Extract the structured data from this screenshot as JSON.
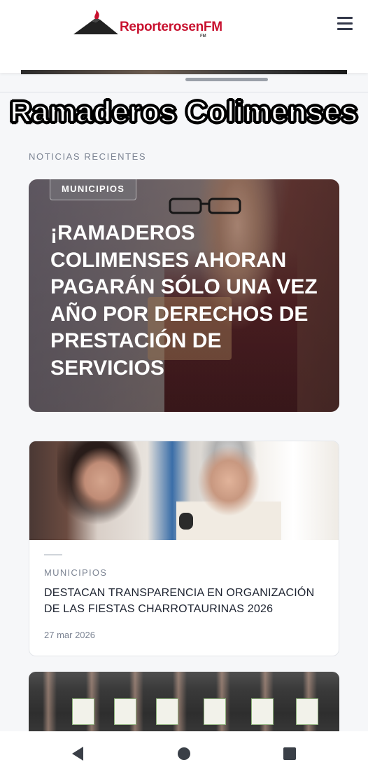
{
  "header": {
    "logo_text": "ReporterosenFM",
    "logo_sub": "FM",
    "menu_icon": "hamburger-icon"
  },
  "overlay": {
    "title": "Ramaderos Colimenses"
  },
  "section": {
    "label": "NOTICIAS RECIENTES"
  },
  "featured": {
    "category": "MUNICIPIOS",
    "title": "¡RAMADEROS COLIMENSES AHORAN PAGARÁN SÓLO UNA VEZ AÑO POR DERECHOS DE PRESTACIÓN DE SERVICIOS"
  },
  "article": {
    "category": "MUNICIPIOS",
    "title": "DESTACAN TRANSPARENCIA EN ORGANIZACIÓN DE LAS FIESTAS CHARROTAURINAS 2026",
    "date": "27 mar 2026"
  },
  "navbar": {
    "back_icon": "back-triangle-icon",
    "home_icon": "home-circle-icon",
    "recent_icon": "recents-square-icon"
  },
  "colors": {
    "brand_red": "#c8102e",
    "text_dark": "#1d2330",
    "muted": "#7d8594",
    "page_bg": "#f6f7f9"
  }
}
